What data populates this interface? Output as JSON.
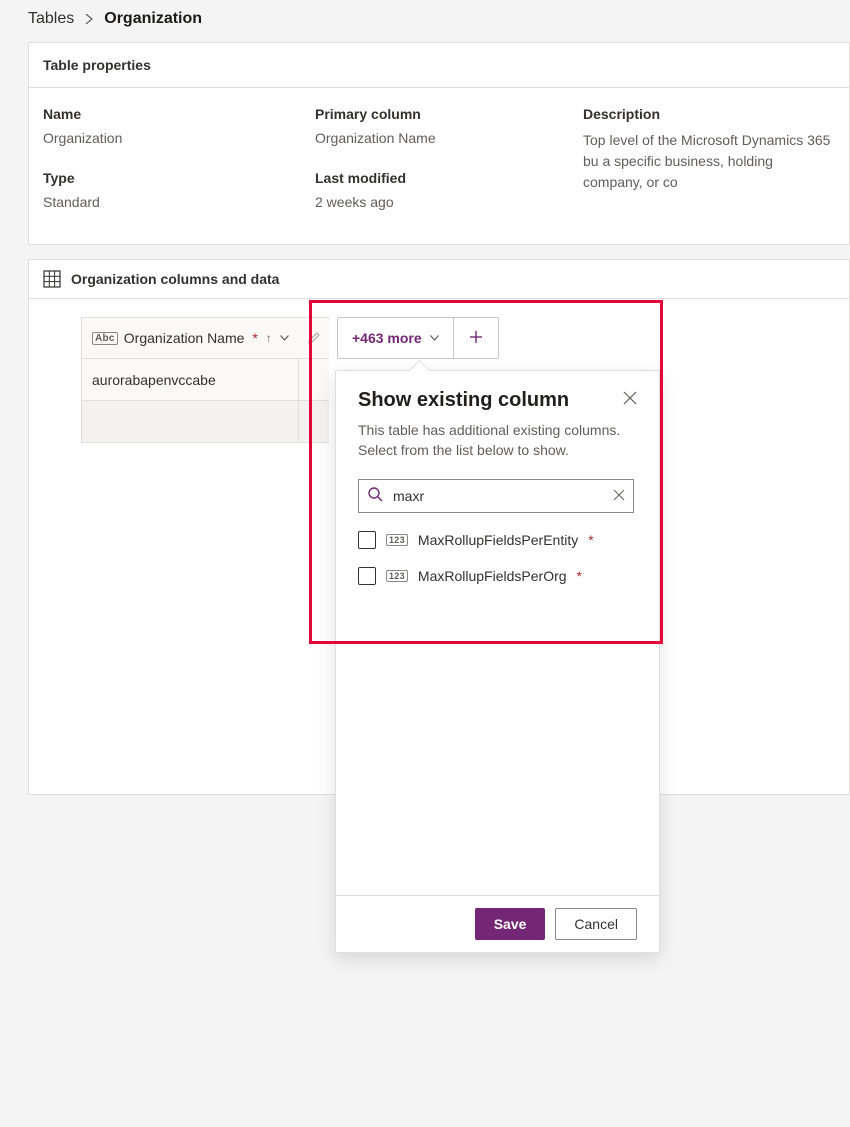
{
  "breadcrumb": {
    "parent": "Tables",
    "current": "Organization"
  },
  "properties_card": {
    "title": "Table properties",
    "name_label": "Name",
    "name_value": "Organization",
    "type_label": "Type",
    "type_value": "Standard",
    "primary_label": "Primary column",
    "primary_value": "Organization Name",
    "modified_label": "Last modified",
    "modified_value": "2 weeks ago",
    "description_label": "Description",
    "description_value": "Top level of the Microsoft Dynamics 365 bu a specific business, holding company, or co"
  },
  "columns_card": {
    "title": "Organization columns and data",
    "column_header": "Organization Name",
    "more_label": "+463 more",
    "rows": [
      {
        "value": "aurorabapenvccabe"
      }
    ]
  },
  "popover": {
    "title": "Show existing column",
    "subtitle": "This table has additional existing columns. Select from the list below to show.",
    "search_value": "maxr",
    "options": [
      {
        "label": "MaxRollupFieldsPerEntity",
        "required": true
      },
      {
        "label": "MaxRollupFieldsPerOrg",
        "required": true
      }
    ],
    "save_label": "Save",
    "cancel_label": "Cancel"
  }
}
